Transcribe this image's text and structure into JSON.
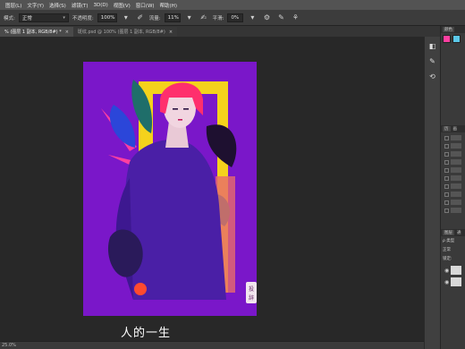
{
  "menubar": {
    "items": [
      "图层(L)",
      "文字(Y)",
      "选择(S)",
      "滤镜(T)",
      "3D(D)",
      "视图(V)",
      "窗口(W)",
      "帮助(H)"
    ]
  },
  "options": {
    "mode_label": "模式:",
    "mode_value": "正常",
    "opacity_label": "不透明度:",
    "opacity_value": "100%",
    "flow_label": "流量:",
    "flow_value": "11%",
    "smooth_label": "平滑:",
    "smooth_value": "0%"
  },
  "tabs": [
    {
      "label": "% (图层 1 副本, RGB/8#) *",
      "close": "×"
    },
    {
      "label": "斑纹.psd @ 100% (图层 1 副本, RGB/8#)",
      "close": "×"
    }
  ],
  "canvas": {
    "caption": "人的一生",
    "background_color": "#7a17c9",
    "stamp_text": "投\n辞"
  },
  "statusbar": {
    "zoom": "25.0%"
  },
  "right_panel": {
    "color_tab": "颜色",
    "history_tabs": [
      "历",
      "画"
    ],
    "layers_tabs": [
      "图层",
      "通"
    ],
    "kind_label": "ρ 类型",
    "blend_value": "正常",
    "lock_label": "锁定:"
  },
  "colors": {
    "accent_pink": "#ff3fa0",
    "accent_yellow": "#f4d21c",
    "figure_purple": "#4a1fa6",
    "hair_red": "#ff2f6d"
  }
}
